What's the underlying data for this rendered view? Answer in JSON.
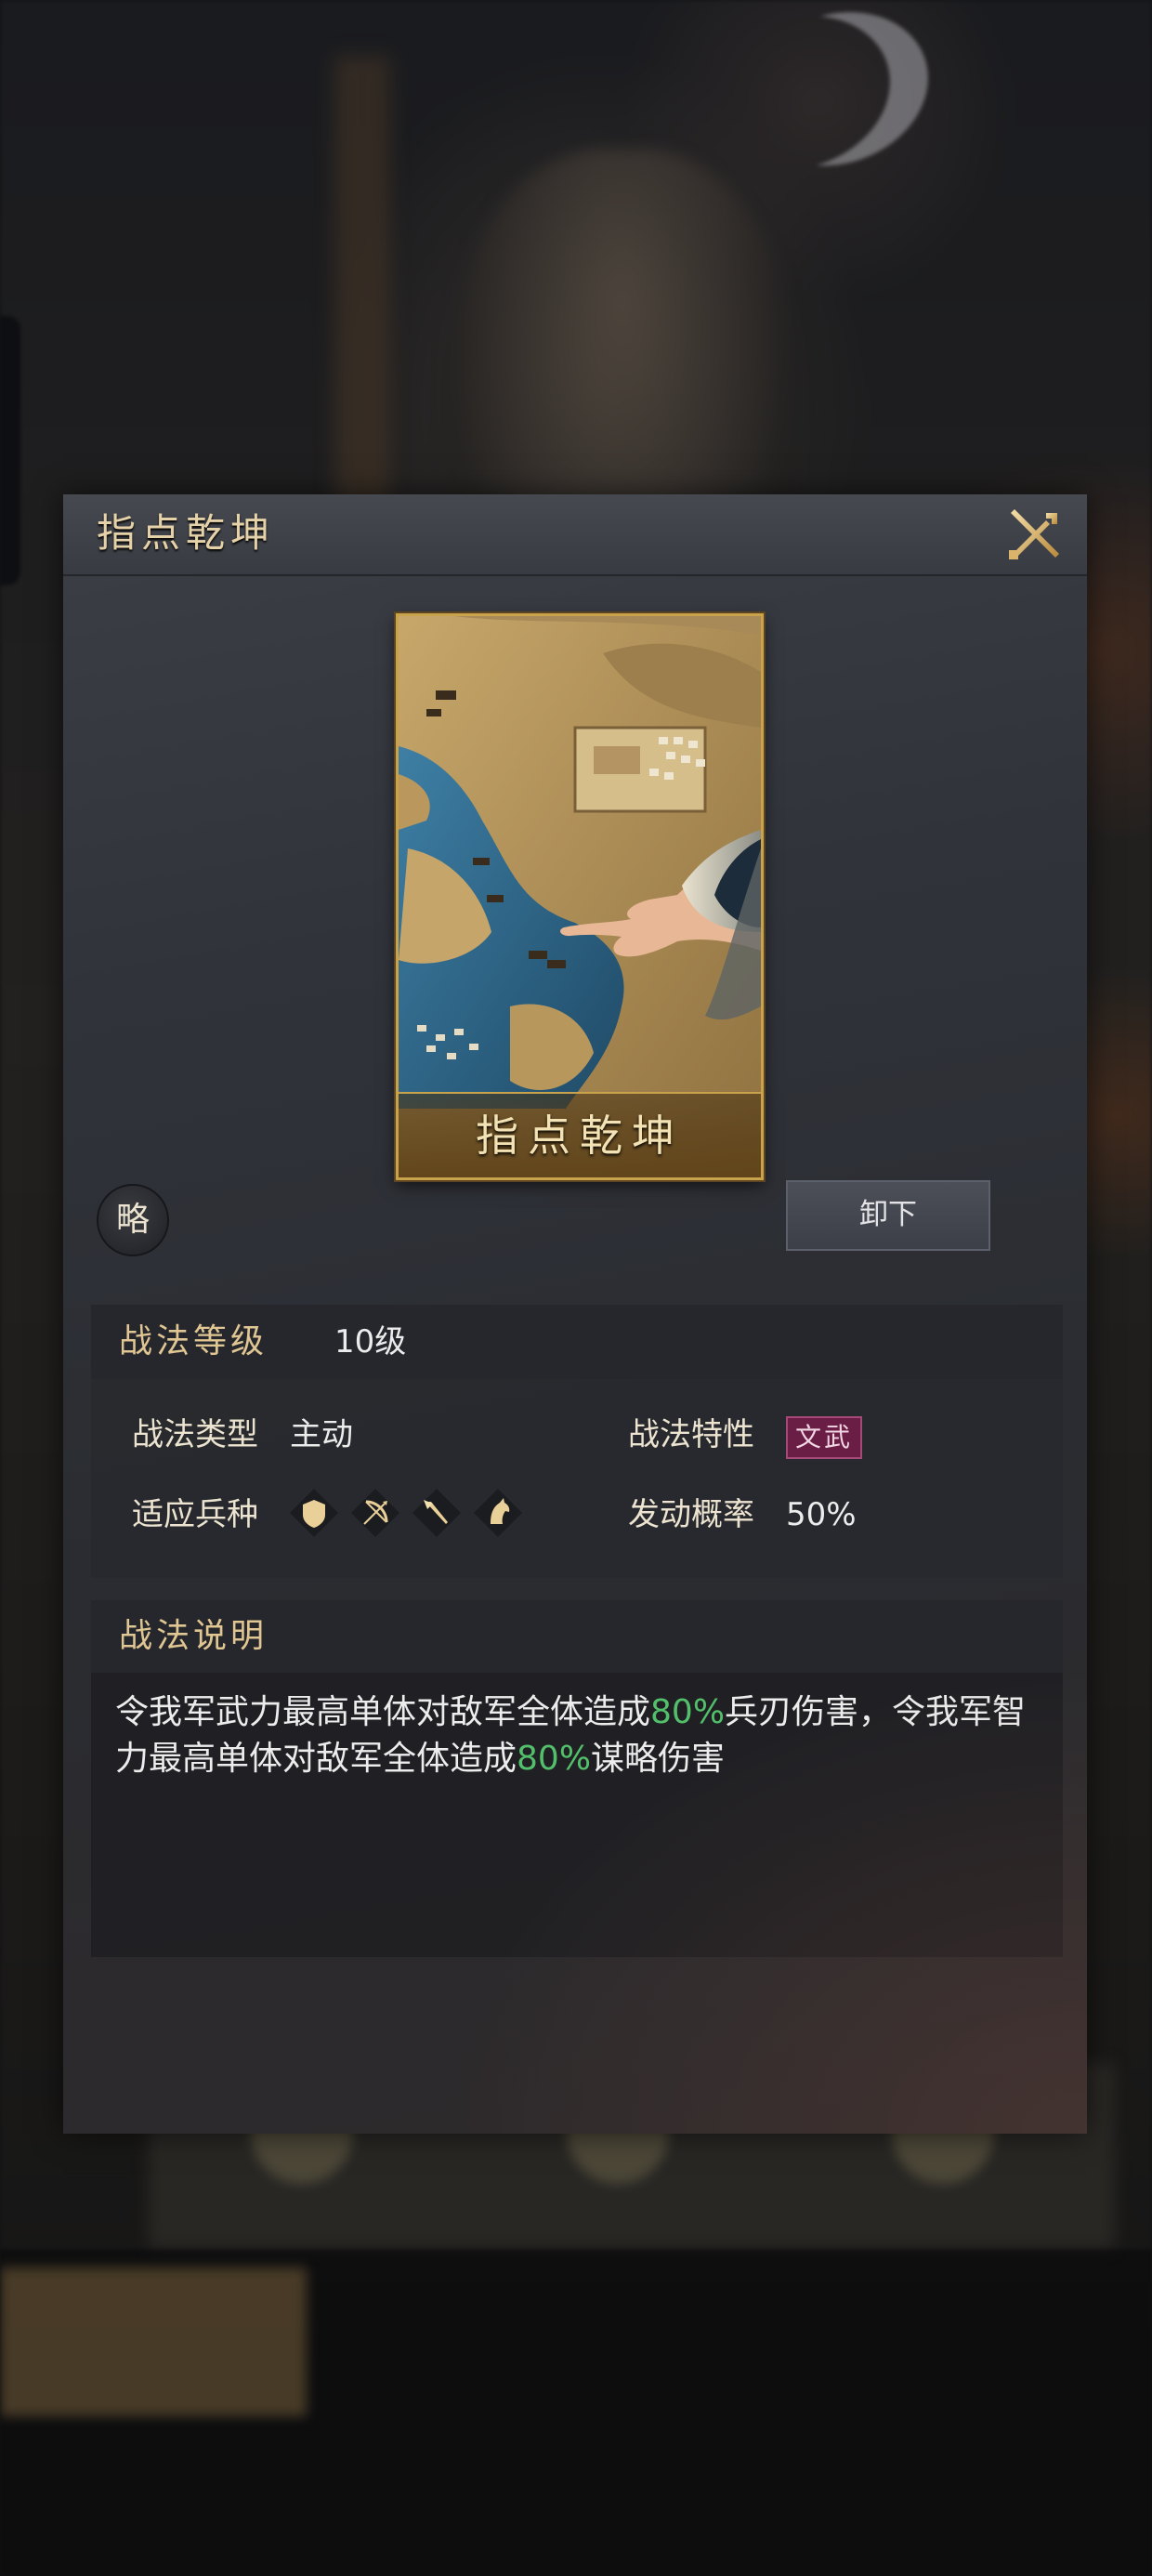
{
  "dialog": {
    "title": "指点乾坤",
    "close_icon": "crossed-swords-close-icon"
  },
  "card": {
    "name": "指点乾坤",
    "art": "map-pointing-hand-artwork"
  },
  "category_badge": "略",
  "unequip_label": "卸下",
  "info": {
    "level_label": "战法等级",
    "level_value": "10级",
    "type_label": "战法类型",
    "type_value": "主动",
    "trait_label": "战法特性",
    "trait_value": "文武",
    "troops_label": "适应兵种",
    "troops": [
      "shield-icon",
      "bow-icon",
      "spear-icon",
      "horse-icon"
    ],
    "rate_label": "发动概率",
    "rate_value": "50%"
  },
  "description": {
    "label": "战法说明",
    "part1": "令我军武力最高单体对敌军全体造成",
    "value1": "80%",
    "part2": "兵刃伤害，令我军智力最高单体对敌军全体造成",
    "value2": "80%",
    "part3": "谋略伤害"
  },
  "colors": {
    "gold_text": "#e0c692",
    "highlight_green": "#52c06a",
    "trait_badge": "#6b1e45"
  }
}
